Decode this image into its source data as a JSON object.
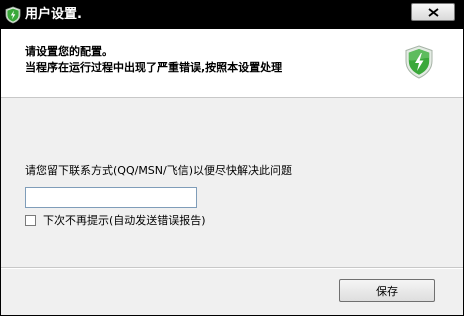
{
  "window": {
    "title": "用户设置.",
    "close_symbol": "✕"
  },
  "header": {
    "line1": "请设置您的配置。",
    "line2": "当程序在运行过程中出现了严重错误,按照本设置处理",
    "icon": "shield-lightning-icon"
  },
  "form": {
    "contact_label": "请您留下联系方式(QQ/MSN/飞信)以便尽快解决此问题",
    "contact_value": "",
    "contact_placeholder": "",
    "checkbox_label": "下次不再提示(自动发送错误报告)",
    "checkbox_checked": false
  },
  "footer": {
    "save_label": "保存"
  },
  "colors": {
    "titlebar": "#000000",
    "header_bg": "#ffffff",
    "body_bg": "#f0f0f0",
    "shield_green": "#3aa83a"
  }
}
